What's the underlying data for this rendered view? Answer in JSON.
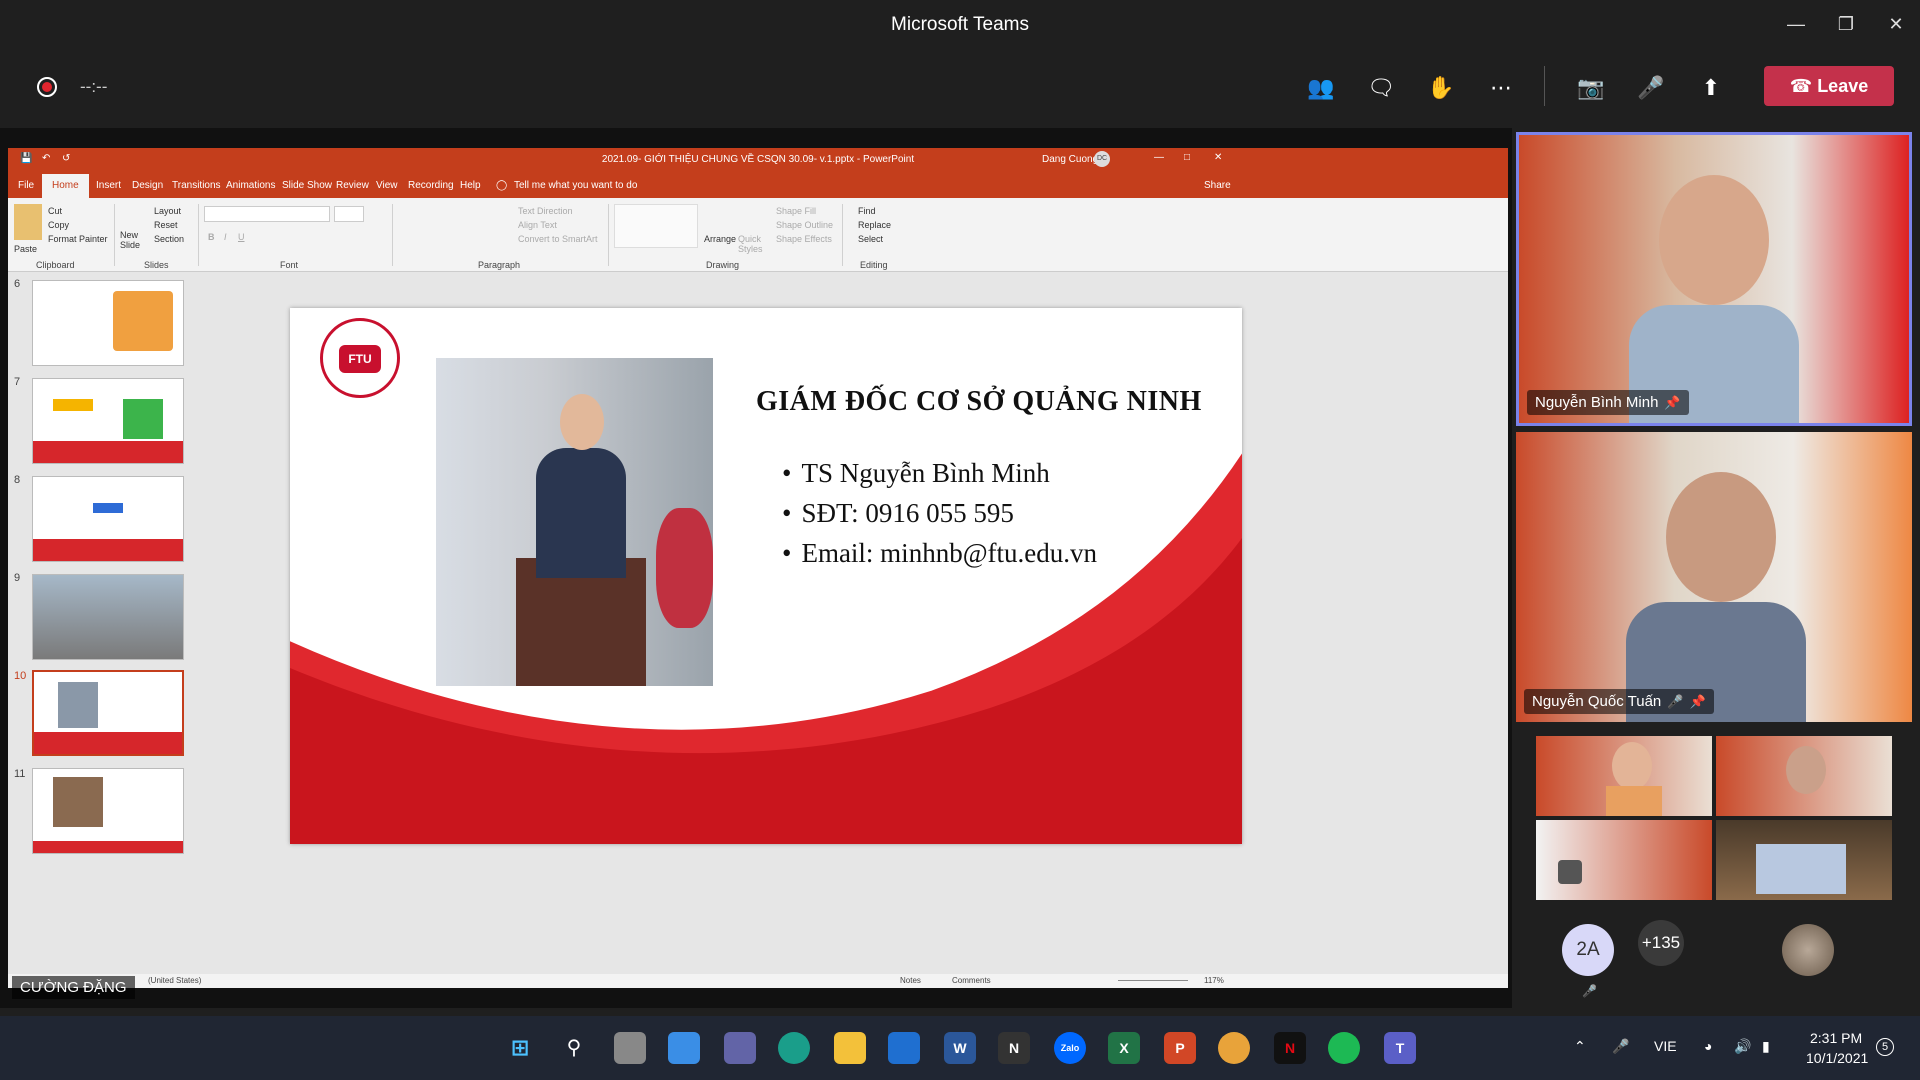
{
  "window": {
    "title": "Microsoft Teams"
  },
  "meeting": {
    "timer": "--:--",
    "leave_label": "Leave",
    "controls": [
      "people-icon",
      "chat-icon",
      "reactions-icon",
      "more-icon",
      "camera-off-icon",
      "mic-off-icon",
      "share-icon"
    ]
  },
  "powerpoint": {
    "title": "2021.09- GIỚI THIỆU CHUNG VỀ CSQN 30.09- v.1.pptx  -  PowerPoint",
    "user": "Dang Cuong",
    "user_initials": "DC",
    "tabs": [
      "File",
      "Home",
      "Insert",
      "Design",
      "Transitions",
      "Animations",
      "Slide Show",
      "Review",
      "View",
      "Recording",
      "Help"
    ],
    "active_tab": "Home",
    "tell_me": "Tell me what you want to do",
    "share": "Share",
    "ribbon": {
      "clipboard": {
        "paste": "Paste",
        "cut": "Cut",
        "copy": "Copy",
        "format_painter": "Format Painter",
        "label": "Clipboard"
      },
      "slides": {
        "new_slide": "New Slide",
        "layout": "Layout",
        "reset": "Reset",
        "section": "Section",
        "label": "Slides"
      },
      "font": {
        "label": "Font"
      },
      "paragraph": {
        "text_direction": "Text Direction",
        "align_text": "Align Text",
        "convert": "Convert to SmartArt",
        "label": "Paragraph"
      },
      "drawing": {
        "arrange": "Arrange",
        "quick_styles": "Quick Styles",
        "shape_fill": "Shape Fill",
        "shape_outline": "Shape Outline",
        "shape_effects": "Shape Effects",
        "label": "Drawing"
      },
      "editing": {
        "find": "Find",
        "replace": "Replace",
        "select": "Select",
        "label": "Editing"
      }
    },
    "thumbnails": [
      {
        "num": "6"
      },
      {
        "num": "7"
      },
      {
        "num": "8"
      },
      {
        "num": "9"
      },
      {
        "num": "10",
        "selected": true
      },
      {
        "num": "11"
      }
    ],
    "slide": {
      "heading": "GIÁM ĐỐC CƠ SỞ QUẢNG NINH",
      "bullets": [
        "TS Nguyễn Bình Minh",
        "SĐT: 0916 055 595",
        "Email: minhnb@ftu.edu.vn"
      ]
    },
    "status": {
      "language": "(United States)",
      "notes": "Notes",
      "comments": "Comments",
      "zoom": "117%"
    }
  },
  "presenter_overlay": "CƯỜNG ĐẶNG",
  "participants": [
    {
      "name": "Nguyễn Bình Minh"
    },
    {
      "name": "Nguyễn Quốc Tuấn"
    }
  ],
  "avatars": {
    "initials": "2A",
    "more_count": "+135"
  },
  "taskbar": {
    "language": "VIE",
    "time": "2:31 PM",
    "date": "10/1/2021",
    "notifications": "5"
  }
}
